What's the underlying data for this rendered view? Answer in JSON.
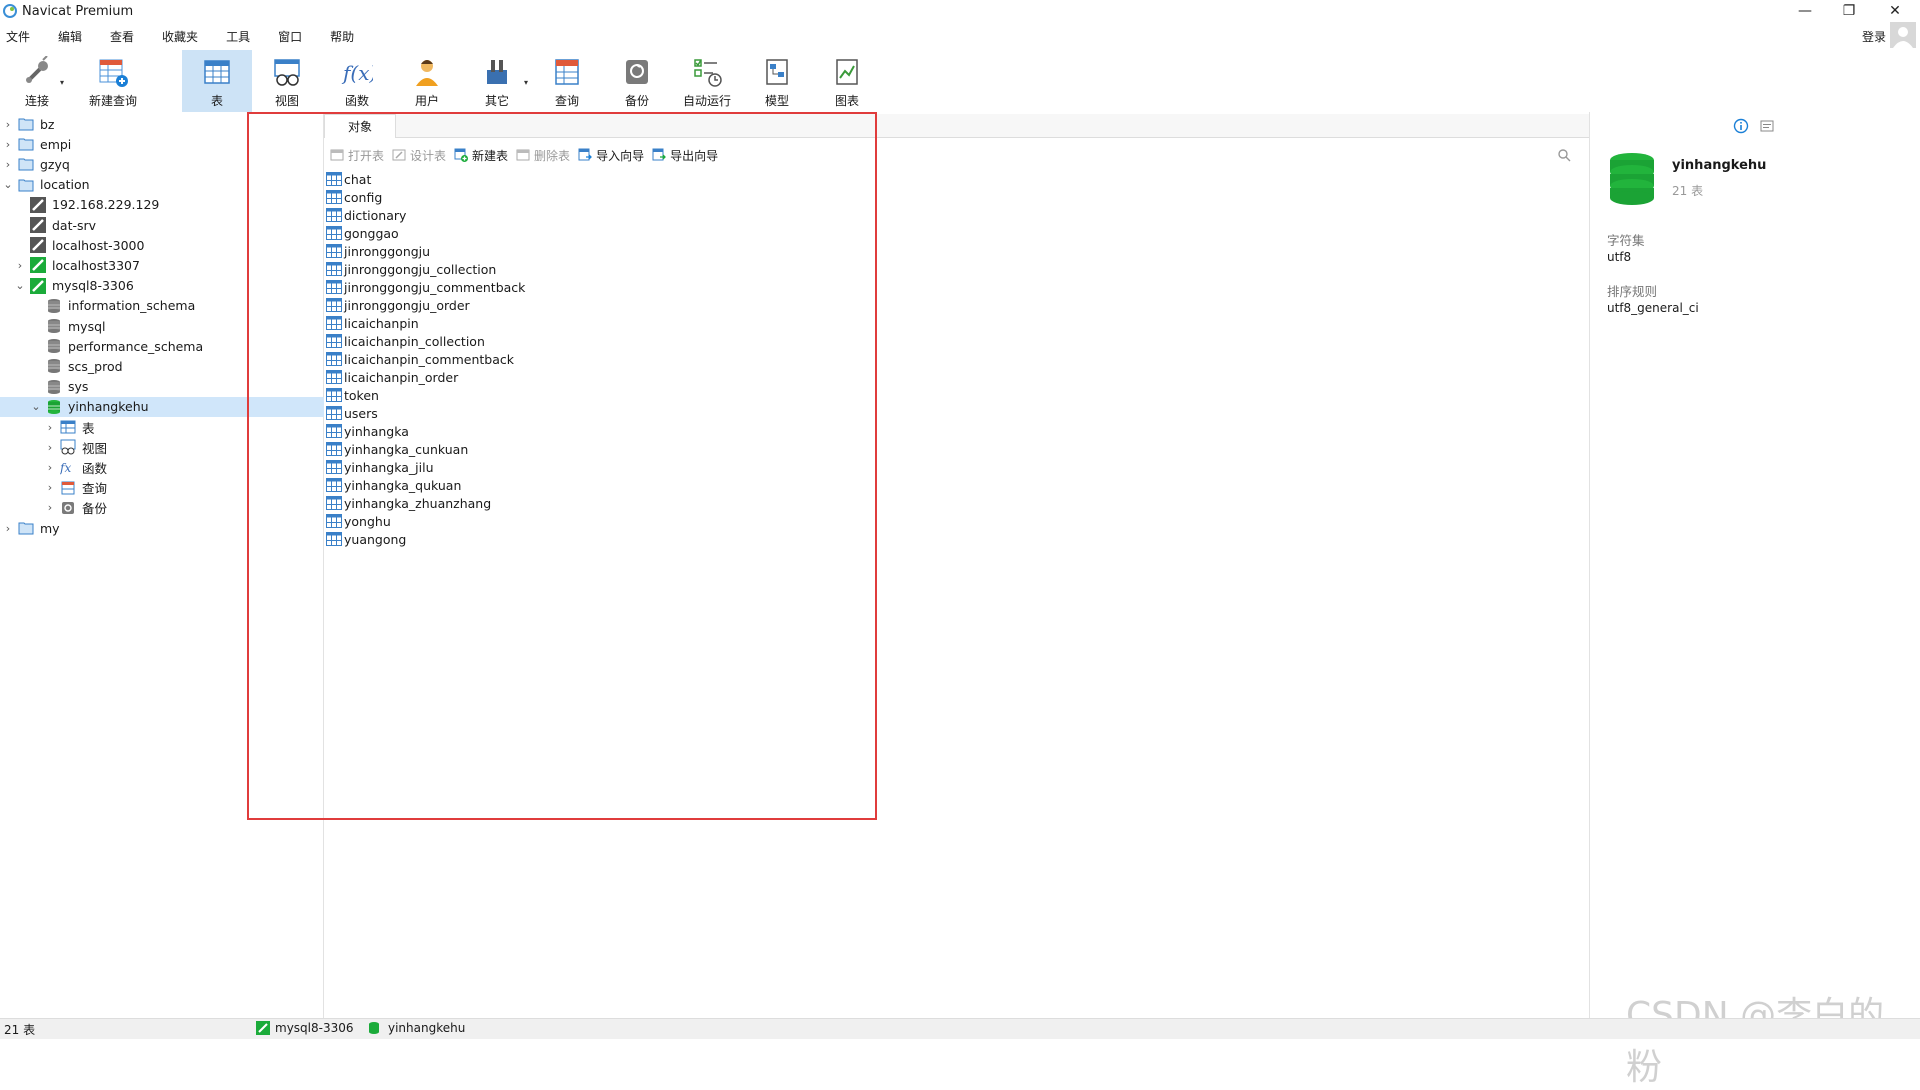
{
  "window": {
    "title": "Navicat Premium"
  },
  "menu": [
    "文件",
    "编辑",
    "查看",
    "收藏夹",
    "工具",
    "窗口",
    "帮助"
  ],
  "login_label": "登录",
  "toolbar": [
    {
      "label": "连接",
      "icon": "connect-icon",
      "dropdown": true
    },
    {
      "label": "新建查询",
      "icon": "new-query-icon"
    },
    {
      "label": "表",
      "icon": "table-icon",
      "active": true
    },
    {
      "label": "视图",
      "icon": "view-icon"
    },
    {
      "label": "函数",
      "icon": "function-icon"
    },
    {
      "label": "用户",
      "icon": "user-icon"
    },
    {
      "label": "其它",
      "icon": "other-icon",
      "dropdown": true
    },
    {
      "label": "查询",
      "icon": "query-icon"
    },
    {
      "label": "备份",
      "icon": "backup-icon"
    },
    {
      "label": "自动运行",
      "icon": "automation-icon"
    },
    {
      "label": "模型",
      "icon": "model-icon"
    },
    {
      "label": "图表",
      "icon": "chart-icon"
    }
  ],
  "tree": [
    {
      "label": "bz",
      "depth": 0,
      "type": "folder",
      "chevron": "right"
    },
    {
      "label": "empi",
      "depth": 0,
      "type": "folder",
      "chevron": "right"
    },
    {
      "label": "gzyq",
      "depth": 0,
      "type": "folder",
      "chevron": "right"
    },
    {
      "label": "location",
      "depth": 0,
      "type": "folder",
      "chevron": "down"
    },
    {
      "label": "192.168.229.129",
      "depth": 1,
      "type": "conn-off",
      "chevron": ""
    },
    {
      "label": "dat-srv",
      "depth": 1,
      "type": "conn-off",
      "chevron": ""
    },
    {
      "label": "localhost-3000",
      "depth": 1,
      "type": "conn-off",
      "chevron": ""
    },
    {
      "label": "localhost3307",
      "depth": 1,
      "type": "conn-on",
      "chevron": "right"
    },
    {
      "label": "mysql8-3306",
      "depth": 1,
      "type": "conn-on",
      "chevron": "down"
    },
    {
      "label": "information_schema",
      "depth": 2,
      "type": "db",
      "chevron": ""
    },
    {
      "label": "mysql",
      "depth": 2,
      "type": "db",
      "chevron": ""
    },
    {
      "label": "performance_schema",
      "depth": 2,
      "type": "db",
      "chevron": ""
    },
    {
      "label": "scs_prod",
      "depth": 2,
      "type": "db",
      "chevron": ""
    },
    {
      "label": "sys",
      "depth": 2,
      "type": "db",
      "chevron": ""
    },
    {
      "label": "yinhangkehu",
      "depth": 2,
      "type": "db-open",
      "chevron": "down",
      "selected": true
    },
    {
      "label": "表",
      "depth": 3,
      "type": "tables",
      "chevron": "right"
    },
    {
      "label": "视图",
      "depth": 3,
      "type": "views",
      "chevron": "right"
    },
    {
      "label": "函数",
      "depth": 3,
      "type": "functions",
      "chevron": "right"
    },
    {
      "label": "查询",
      "depth": 3,
      "type": "queries",
      "chevron": "right"
    },
    {
      "label": "备份",
      "depth": 3,
      "type": "backups",
      "chevron": "right"
    },
    {
      "label": "my",
      "depth": 0,
      "type": "folder",
      "chevron": "right"
    }
  ],
  "object_tab": "对象",
  "actions": [
    {
      "label": "打开表",
      "disabled": true,
      "icon": "open-table-icon"
    },
    {
      "label": "设计表",
      "disabled": true,
      "icon": "design-table-icon"
    },
    {
      "label": "新建表",
      "disabled": false,
      "icon": "new-table-icon"
    },
    {
      "label": "删除表",
      "disabled": true,
      "icon": "delete-table-icon"
    },
    {
      "label": "导入向导",
      "disabled": false,
      "icon": "import-wizard-icon"
    },
    {
      "label": "导出向导",
      "disabled": false,
      "icon": "export-wizard-icon"
    }
  ],
  "tables": [
    "chat",
    "config",
    "dictionary",
    "gonggao",
    "jinronggongju",
    "jinronggongju_collection",
    "jinronggongju_commentback",
    "jinronggongju_order",
    "licaichanpin",
    "licaichanpin_collection",
    "licaichanpin_commentback",
    "licaichanpin_order",
    "token",
    "users",
    "yinhangka",
    "yinhangka_cunkuan",
    "yinhangka_jilu",
    "yinhangka_qukuan",
    "yinhangka_zhuanzhang",
    "yonghu",
    "yuangong"
  ],
  "info": {
    "db_name": "yinhangkehu",
    "table_count": "21 表",
    "charset_label": "字符集",
    "charset_value": "utf8",
    "collation_label": "排序规则",
    "collation_value": "utf8_general_ci"
  },
  "status": {
    "count": "21 表",
    "connection": "mysql8-3306",
    "database": "yinhangkehu"
  },
  "watermark": "CSDN @李白的粉",
  "colors": {
    "accent": "#1a7fd6",
    "green": "#1bab3a",
    "selected": "#d0e6fa",
    "highlight_box": "#e03c3c"
  }
}
